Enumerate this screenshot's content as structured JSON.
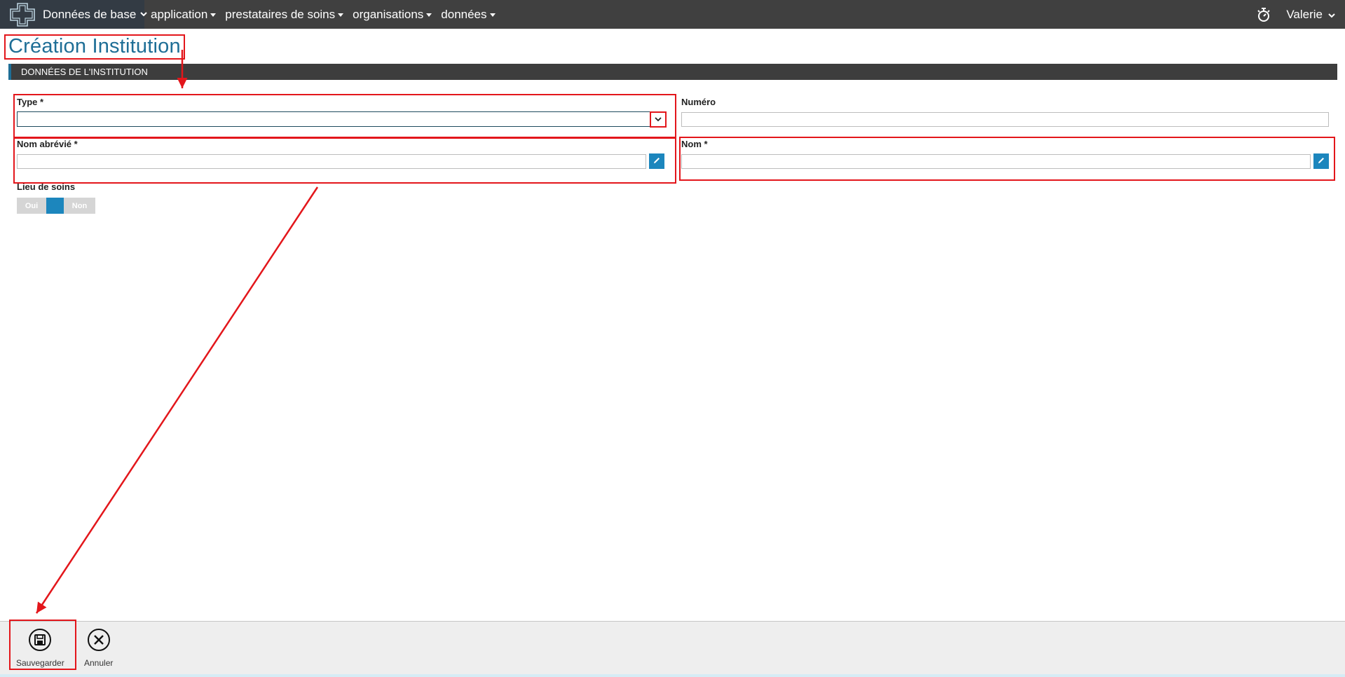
{
  "topbar": {
    "brand_label": "Données de base",
    "menu": [
      {
        "label": "application"
      },
      {
        "label": "prestataires de soins"
      },
      {
        "label": "organisations"
      },
      {
        "label": "données"
      }
    ],
    "user": "Valerie",
    "icons": {
      "logo": "medical-cross-logo",
      "timer": "stopwatch-icon",
      "dropdown": "chevron-down-icon"
    }
  },
  "page": {
    "title": "Création Institution",
    "section": "DONNÉES DE L'INSTITUTION"
  },
  "form": {
    "type": {
      "label": "Type *",
      "value": ""
    },
    "numero": {
      "label": "Numéro",
      "value": ""
    },
    "nom_abrege": {
      "label": "Nom abrévié *",
      "value": ""
    },
    "nom": {
      "label": "Nom *",
      "value": ""
    },
    "lieu_de_soins": {
      "label": "Lieu de soins",
      "yes": "Oui",
      "no": "Non"
    }
  },
  "footer": {
    "save_label": "Sauvegarder",
    "cancel_label": "Annuler"
  },
  "colors": {
    "accent": "#1e6e96",
    "button_blue": "#1c86bd",
    "annotation_red": "#e3161b",
    "topbar": "#404040"
  }
}
